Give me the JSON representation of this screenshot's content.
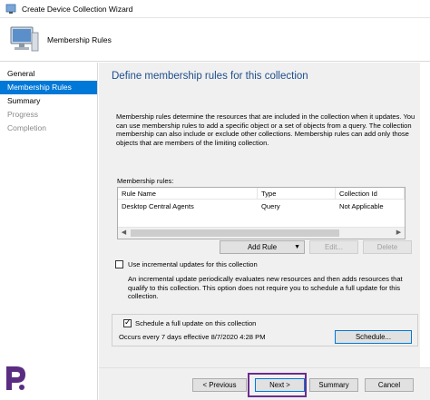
{
  "window": {
    "title": "Create Device Collection Wizard"
  },
  "header": {
    "title": "Membership Rules"
  },
  "sidebar": {
    "items": [
      {
        "label": "General"
      },
      {
        "label": "Membership Rules"
      },
      {
        "label": "Summary"
      },
      {
        "label": "Progress"
      },
      {
        "label": "Completion"
      }
    ]
  },
  "main": {
    "title": "Define membership rules for this collection",
    "description": "Membership rules determine the resources that are included in the collection when it updates. You can use membership rules to add a specific object or a set of objects from a query. The collection membership can also include or exclude other collections. Membership rules can add only those objects that are members of the limiting collection.",
    "rules_label": "Membership rules:",
    "table": {
      "columns": [
        "Rule Name",
        "Type",
        "Collection Id"
      ],
      "rows": [
        [
          "Desktop Central Agents",
          "Query",
          "Not Applicable"
        ]
      ]
    },
    "buttons": {
      "add_rule": "Add Rule",
      "edit": "Edit...",
      "delete": "Delete"
    },
    "incremental": {
      "label": "Use incremental updates for this collection",
      "checked": false,
      "description": "An incremental update periodically evaluates new resources and then adds resources that qualify to this collection. This option does not require you to schedule a full update for this collection."
    },
    "schedule": {
      "label": "Schedule a full update on this collection",
      "checked": true,
      "text": "Occurs every 7 days effective 8/7/2020 4:28 PM",
      "button": "Schedule..."
    }
  },
  "footer": {
    "previous": "< Previous",
    "next": "Next >",
    "summary": "Summary",
    "cancel": "Cancel"
  },
  "colors": {
    "accent": "#0078d7",
    "title_blue": "#1e4e8c",
    "highlight_purple": "#6b2c91"
  }
}
